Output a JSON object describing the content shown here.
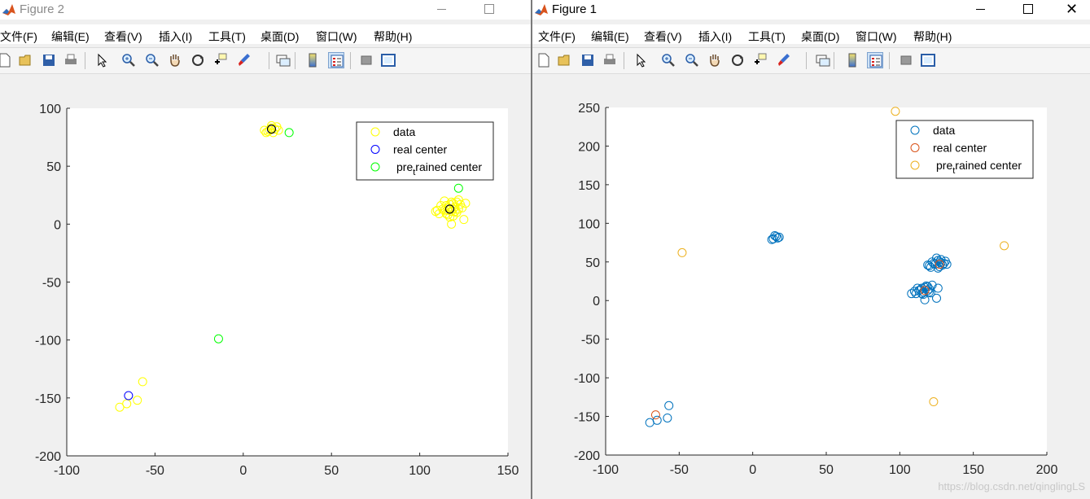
{
  "figure2": {
    "title": "Figure 2",
    "menus": [
      "文件(F)",
      "编辑(E)",
      "查看(V)",
      "插入(I)",
      "工具(T)",
      "桌面(D)",
      "窗口(W)",
      "帮助(H)"
    ],
    "toolbar_icons": [
      "new-figure-icon",
      "open-file-icon",
      "save-icon",
      "print-icon",
      "edit-plot-arrow-icon",
      "zoom-in-icon",
      "zoom-out-icon",
      "pan-hand-icon",
      "rotate-3d-icon",
      "data-cursor-icon",
      "brush-icon",
      "link-plot-icon",
      "colorbar-icon",
      "legend-icon",
      "hide-plot-tools-icon",
      "show-plot-tools-icon"
    ]
  },
  "figure1": {
    "title": "Figure 1",
    "menus": [
      "文件(F)",
      "编辑(E)",
      "查看(V)",
      "插入(I)",
      "工具(T)",
      "桌面(D)",
      "窗口(W)",
      "帮助(H)"
    ],
    "toolbar_icons": [
      "new-figure-icon",
      "open-file-icon",
      "save-icon",
      "print-icon",
      "edit-plot-arrow-icon",
      "zoom-in-icon",
      "zoom-out-icon",
      "pan-hand-icon",
      "rotate-3d-icon",
      "data-cursor-icon",
      "brush-icon",
      "link-plot-icon",
      "colorbar-icon",
      "legend-icon",
      "hide-plot-tools-icon",
      "show-plot-tools-icon"
    ]
  },
  "watermark": "https://blog.csdn.net/qinglingLS",
  "chart_data": [
    {
      "type": "scatter",
      "figure": "Figure 2",
      "xlim": [
        -100,
        150
      ],
      "ylim": [
        -200,
        100
      ],
      "xticks": [
        -100,
        -50,
        0,
        50,
        100,
        150
      ],
      "yticks": [
        100,
        50,
        0,
        -50,
        -100,
        -150,
        -200
      ],
      "legend_position": "top-right",
      "series": [
        {
          "name": "data",
          "color": "#ffff00",
          "points": [
            [
              14,
              80
            ],
            [
              16,
              83
            ],
            [
              18,
              82
            ],
            [
              19,
              84
            ],
            [
              13,
              79
            ],
            [
              15,
              81
            ],
            [
              17,
              79
            ],
            [
              20,
              81
            ],
            [
              12,
              81
            ],
            [
              16,
              85
            ],
            [
              114,
              12
            ],
            [
              116,
              14
            ],
            [
              118,
              11
            ],
            [
              120,
              15
            ],
            [
              112,
              16
            ],
            [
              115,
              9
            ],
            [
              119,
              18
            ],
            [
              121,
              10
            ],
            [
              113,
              13
            ],
            [
              117,
              17
            ],
            [
              122,
              13
            ],
            [
              110,
              12
            ],
            [
              116,
              8
            ],
            [
              118,
              19
            ],
            [
              124,
              14
            ],
            [
              111,
              9
            ],
            [
              120,
              11
            ],
            [
              115,
              16
            ],
            [
              119,
              13
            ],
            [
              123,
              17
            ],
            [
              117,
              6
            ],
            [
              121,
              19
            ],
            [
              109,
              11
            ],
            [
              126,
              18
            ],
            [
              125,
              4
            ],
            [
              118,
              0
            ],
            [
              122,
              21
            ],
            [
              114,
              20
            ],
            [
              116,
              12
            ],
            [
              119,
              7
            ],
            [
              -70,
              -158
            ],
            [
              -66,
              -155
            ],
            [
              -60,
              -152
            ],
            [
              -57,
              -136
            ]
          ]
        },
        {
          "name": "real center",
          "color": "#0000ff",
          "points": [
            [
              -65,
              -148
            ],
            [
              16,
              82
            ],
            [
              117,
              13
            ]
          ]
        },
        {
          "name": "pre_trained center",
          "color": "#00ff00",
          "points": [
            [
              26,
              79
            ],
            [
              122,
              31
            ],
            [
              -14,
              -99
            ]
          ]
        }
      ],
      "overlay_black_points": [
        [
          16,
          82
        ],
        [
          117,
          13
        ]
      ]
    },
    {
      "type": "scatter",
      "figure": "Figure 1",
      "xlim": [
        -100,
        200
      ],
      "ylim": [
        -200,
        250
      ],
      "xticks": [
        -100,
        -50,
        0,
        50,
        100,
        150,
        200
      ],
      "yticks": [
        250,
        200,
        150,
        100,
        50,
        0,
        -50,
        -100,
        -150,
        -200
      ],
      "legend_position": "top-right",
      "series": [
        {
          "name": "data",
          "color": "#0072bd",
          "points": [
            [
              14,
              80
            ],
            [
              16,
              83
            ],
            [
              18,
              82
            ],
            [
              15,
              84
            ],
            [
              13,
              79
            ],
            [
              17,
              81
            ],
            [
              120,
              45
            ],
            [
              124,
              47
            ],
            [
              127,
              44
            ],
            [
              130,
              48
            ],
            [
              122,
              50
            ],
            [
              126,
              52
            ],
            [
              128,
              49
            ],
            [
              121,
              43
            ],
            [
              129,
              46
            ],
            [
              125,
              55
            ],
            [
              131,
              51
            ],
            [
              123,
              48
            ],
            [
              126,
              42
            ],
            [
              128,
              53
            ],
            [
              132,
              47
            ],
            [
              119,
              46
            ],
            [
              127,
              50
            ],
            [
              110,
              12
            ],
            [
              114,
              14
            ],
            [
              116,
              11
            ],
            [
              120,
              15
            ],
            [
              112,
              16
            ],
            [
              115,
              9
            ],
            [
              119,
              18
            ],
            [
              121,
              10
            ],
            [
              113,
              13
            ],
            [
              117,
              17
            ],
            [
              108,
              9
            ],
            [
              116,
              8
            ],
            [
              118,
              19
            ],
            [
              126,
              16
            ],
            [
              111,
              9
            ],
            [
              120,
              11
            ],
            [
              115,
              16
            ],
            [
              119,
              13
            ],
            [
              117,
              1
            ],
            [
              125,
              3
            ],
            [
              122,
              20
            ],
            [
              -70,
              -158
            ],
            [
              -65,
              -155
            ],
            [
              -58,
              -152
            ],
            [
              -57,
              -136
            ]
          ]
        },
        {
          "name": "real center",
          "color": "#d95319",
          "points": [
            [
              -66,
              -148
            ],
            [
              127,
              47
            ],
            [
              117,
              13
            ]
          ]
        },
        {
          "name": "pre_trained center",
          "color": "#edb120",
          "points": [
            [
              97,
              245
            ],
            [
              171,
              71
            ],
            [
              -48,
              62
            ],
            [
              123,
              -131
            ]
          ]
        }
      ]
    }
  ]
}
